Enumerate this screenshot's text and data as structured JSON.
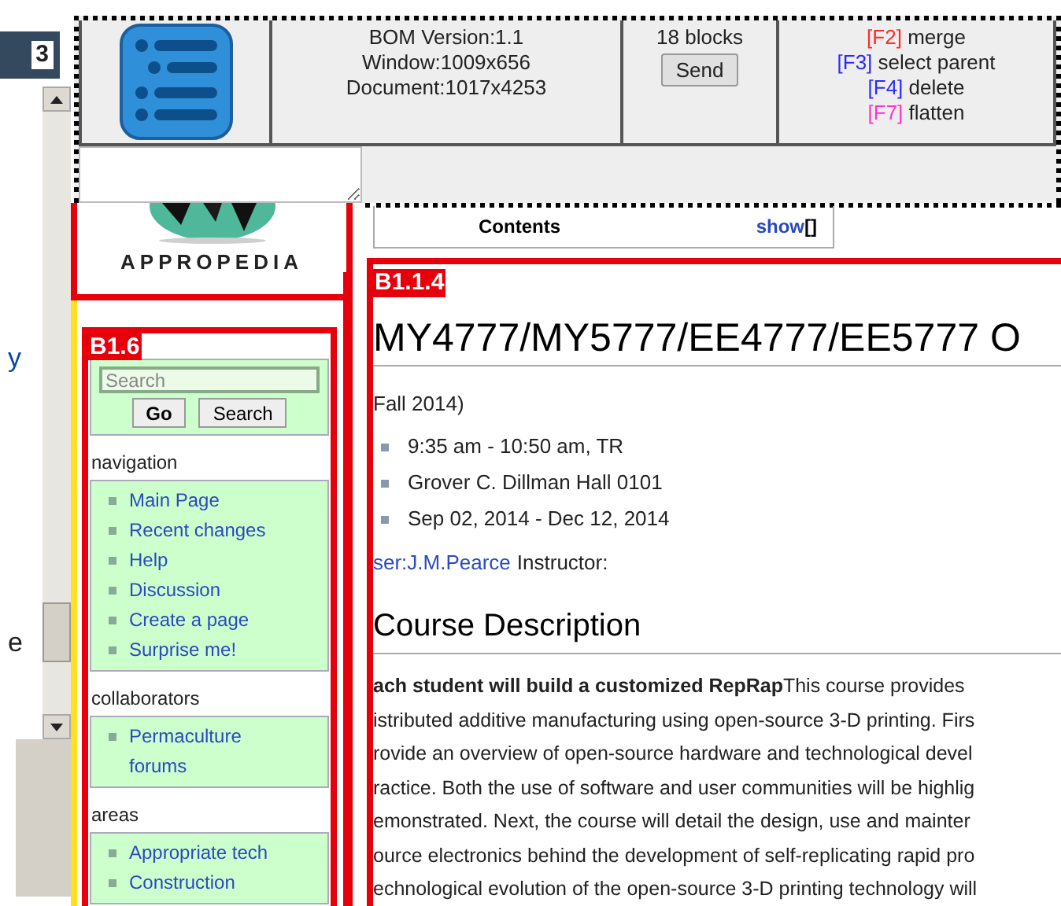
{
  "tab_number": "3",
  "left_fragments": [
    "y",
    "e"
  ],
  "toolbar": {
    "info": [
      "BOM Version:1.1",
      "Window:1009x656",
      "Document:1017x4253"
    ],
    "blocks": "18 blocks",
    "send": "Send",
    "shortcuts": [
      {
        "key": "[F2]",
        "action": "merge",
        "color": "#ff2a2a"
      },
      {
        "key": "[F3]",
        "action": "select parent",
        "color": "#2a2aff"
      },
      {
        "key": "[F4]",
        "action": "delete",
        "color": "#2a2aff"
      },
      {
        "key": "[F7]",
        "action": "flatten",
        "color": "#ff33cc"
      }
    ]
  },
  "logo": {
    "text": "APPROPEDIA"
  },
  "sidebar": {
    "label": "B1.6",
    "search": {
      "placeholder": "Search"
    },
    "buttons": [
      "Go",
      "Search"
    ],
    "sections": [
      {
        "heading": "navigation",
        "links": [
          "Main Page",
          "Recent changes",
          "Help",
          "Discussion",
          "Create a page",
          "Surprise me!"
        ]
      },
      {
        "heading": "collaborators",
        "links": [
          "Permaculture forums"
        ]
      },
      {
        "heading": "areas",
        "links": [
          "Appropriate tech",
          "Construction"
        ]
      }
    ]
  },
  "toc": {
    "title": "Contents",
    "toggle": "show",
    "bracket": "[]"
  },
  "content": {
    "label": "B1.1.4",
    "title": "MY4777/MY5777/EE4777/EE5777 O",
    "subtitle": "Fall 2014)",
    "details": [
      "9:35 am - 10:50 am, TR",
      "Grover C. Dillman Hall 0101",
      "Sep 02, 2014 - Dec 12, 2014"
    ],
    "instructor_link": "ser:J.M.Pearce",
    "instructor_text": "Instructor:",
    "section_heading": "Course Description",
    "lines": [
      "**ach student will build a customized RepRap**This course provides",
      "istributed additive manufacturing using open-source 3-D printing. Firs",
      "rovide an overview of open-source hardware and technological devel",
      "ractice. Both the use of software and user communities will be highlig",
      "emonstrated. Next, the course will detail the design, use and mainter",
      "ource electronics behind the development of self-replicating rapid pro",
      "echnological evolution of the open-source 3-D printing technology will"
    ]
  }
}
